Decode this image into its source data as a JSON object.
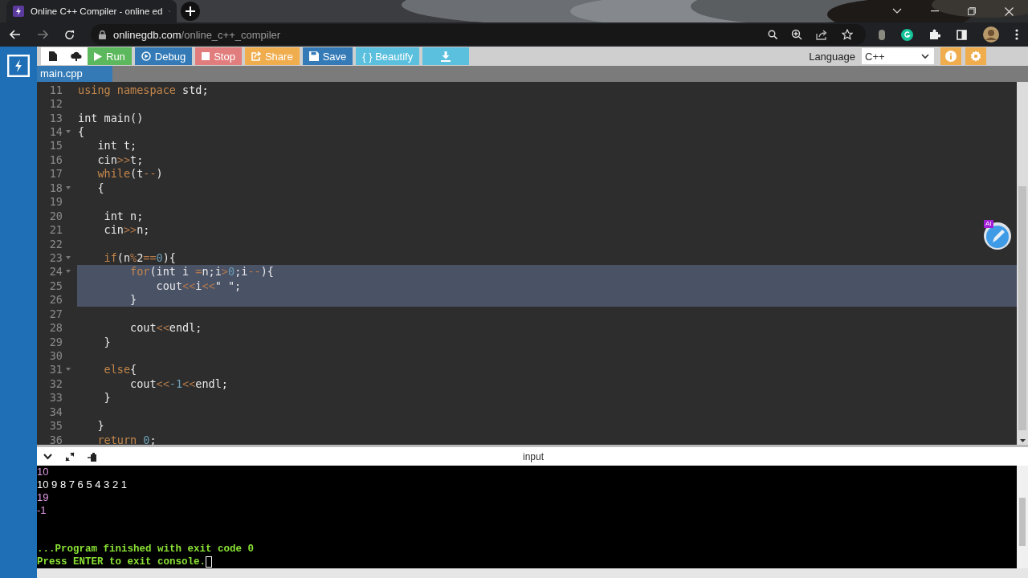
{
  "browser": {
    "tab": {
      "title": "Online C++ Compiler - online ed"
    },
    "address": {
      "host": "onlinegdb.com",
      "path": "/online_c++_compiler"
    },
    "forward_disabled": true
  },
  "toolbar": {
    "buttons": [
      {
        "kind": "new"
      },
      {
        "kind": "upload"
      },
      {
        "kind": "run",
        "label": "Run"
      },
      {
        "kind": "debug",
        "label": "Debug"
      },
      {
        "kind": "stop",
        "label": "Stop"
      },
      {
        "kind": "share",
        "label": "Share"
      },
      {
        "kind": "save",
        "label": "Save"
      },
      {
        "kind": "beautify",
        "label": "{ } Beautify"
      },
      {
        "kind": "download"
      }
    ],
    "language": {
      "label": "Language",
      "value": "C++"
    }
  },
  "file_tabs": [
    {
      "label": "main.cpp",
      "selected": true
    }
  ],
  "editor": {
    "lines": [
      {
        "n": "11",
        "fold": false,
        "selected": false,
        "tokens": [
          {
            "text": "using namespace",
            "kind": "keyword"
          },
          {
            "text": " std;",
            "kind": "name"
          }
        ]
      },
      {
        "n": "12",
        "fold": false,
        "selected": false
      },
      {
        "n": "13",
        "fold": false,
        "selected": false,
        "tokens": [
          {
            "text": "int main()",
            "kind": "name"
          }
        ]
      },
      {
        "n": "14",
        "fold": true,
        "selected": false,
        "tokens": [
          {
            "text": "{",
            "kind": "name"
          }
        ]
      },
      {
        "n": "15",
        "fold": false,
        "selected": false,
        "tokens": [
          {
            "text": "   int t;",
            "kind": "name"
          }
        ]
      },
      {
        "n": "16",
        "fold": false,
        "selected": false,
        "tokens": [
          {
            "text": "   cin",
            "kind": "name"
          },
          {
            "text": ">>",
            "kind": "operator"
          },
          {
            "text": "t;",
            "kind": "name"
          }
        ]
      },
      {
        "n": "17",
        "fold": false,
        "selected": false,
        "tokens": [
          {
            "text": "   while",
            "kind": "keyword"
          },
          {
            "text": "(t",
            "kind": "name"
          },
          {
            "text": "--",
            "kind": "operator"
          },
          {
            "text": ")",
            "kind": "name"
          }
        ]
      },
      {
        "n": "18",
        "fold": true,
        "selected": false,
        "tokens": [
          {
            "text": "   {",
            "kind": "name"
          }
        ]
      },
      {
        "n": "19",
        "fold": false,
        "selected": false
      },
      {
        "n": "20",
        "fold": false,
        "selected": false,
        "tokens": [
          {
            "text": "    int n;",
            "kind": "name"
          }
        ]
      },
      {
        "n": "21",
        "fold": false,
        "selected": false,
        "tokens": [
          {
            "text": "    cin",
            "kind": "name"
          },
          {
            "text": ">>",
            "kind": "operator"
          },
          {
            "text": "n;",
            "kind": "name"
          }
        ]
      },
      {
        "n": "22",
        "fold": false,
        "selected": false
      },
      {
        "n": "23",
        "fold": true,
        "selected": false,
        "tokens": [
          {
            "text": "    if",
            "kind": "keyword"
          },
          {
            "text": "(n",
            "kind": "name"
          },
          {
            "text": "%",
            "kind": "operator"
          },
          {
            "text": "2",
            "kind": "name"
          },
          {
            "text": "==",
            "kind": "operator"
          },
          {
            "text": "0",
            "kind": "number"
          },
          {
            "text": "){",
            "kind": "name"
          }
        ]
      },
      {
        "n": "24",
        "fold": true,
        "selected": true,
        "tokens": [
          {
            "text": "        for",
            "kind": "keyword"
          },
          {
            "text": "(int i ",
            "kind": "name"
          },
          {
            "text": "=",
            "kind": "operator"
          },
          {
            "text": "n;i",
            "kind": "name"
          },
          {
            "text": ">",
            "kind": "operator"
          },
          {
            "text": "0",
            "kind": "number"
          },
          {
            "text": ";i",
            "kind": "name"
          },
          {
            "text": "--",
            "kind": "operator"
          },
          {
            "text": "){",
            "kind": "name"
          }
        ]
      },
      {
        "n": "25",
        "fold": false,
        "selected": true,
        "tokens": [
          {
            "text": "            cout",
            "kind": "name"
          },
          {
            "text": "<<",
            "kind": "operator"
          },
          {
            "text": "i",
            "kind": "name"
          },
          {
            "text": "<<",
            "kind": "operator"
          },
          {
            "text": "\" \"",
            "kind": "string"
          },
          {
            "text": ";",
            "kind": "name"
          }
        ]
      },
      {
        "n": "26",
        "fold": false,
        "selected": true,
        "tokens": [
          {
            "text": "        }",
            "kind": "name"
          }
        ]
      },
      {
        "n": "27",
        "fold": false,
        "selected": false
      },
      {
        "n": "28",
        "fold": false,
        "selected": false,
        "tokens": [
          {
            "text": "        cout",
            "kind": "name"
          },
          {
            "text": "<<",
            "kind": "operator"
          },
          {
            "text": "endl;",
            "kind": "name"
          }
        ]
      },
      {
        "n": "29",
        "fold": false,
        "selected": false,
        "tokens": [
          {
            "text": "    }",
            "kind": "name"
          }
        ]
      },
      {
        "n": "30",
        "fold": false,
        "selected": false
      },
      {
        "n": "31",
        "fold": true,
        "selected": false,
        "tokens": [
          {
            "text": "    else",
            "kind": "keyword"
          },
          {
            "text": "{",
            "kind": "name"
          }
        ]
      },
      {
        "n": "32",
        "fold": false,
        "selected": false,
        "tokens": [
          {
            "text": "        cout",
            "kind": "name"
          },
          {
            "text": "<<",
            "kind": "operator"
          },
          {
            "text": "-1",
            "kind": "number"
          },
          {
            "text": "<<",
            "kind": "operator"
          },
          {
            "text": "endl;",
            "kind": "name"
          }
        ]
      },
      {
        "n": "33",
        "fold": false,
        "selected": false,
        "tokens": [
          {
            "text": "    }",
            "kind": "name"
          }
        ]
      },
      {
        "n": "34",
        "fold": false,
        "selected": false
      },
      {
        "n": "35",
        "fold": false,
        "selected": false,
        "tokens": [
          {
            "text": "   }",
            "kind": "name"
          }
        ]
      },
      {
        "n": "36",
        "fold": false,
        "selected": false,
        "tokens": [
          {
            "text": "   return ",
            "kind": "keyword"
          },
          {
            "text": "0",
            "kind": "number"
          },
          {
            "text": ";",
            "kind": "name"
          }
        ]
      }
    ],
    "ai_badge": "AI"
  },
  "console": {
    "title": "input",
    "lines": [
      {
        "kind": "input",
        "text": "10"
      },
      {
        "kind": "output",
        "text": "10 9 8 7 6 5 4 3 2 1"
      },
      {
        "kind": "input",
        "text": "19"
      },
      {
        "kind": "input",
        "text": "-1"
      },
      {
        "kind": "blank"
      },
      {
        "kind": "blank"
      },
      {
        "kind": "status",
        "text": "...Program finished with exit code 0"
      },
      {
        "kind": "prompt",
        "text": "Press ENTER to exit console."
      }
    ]
  }
}
